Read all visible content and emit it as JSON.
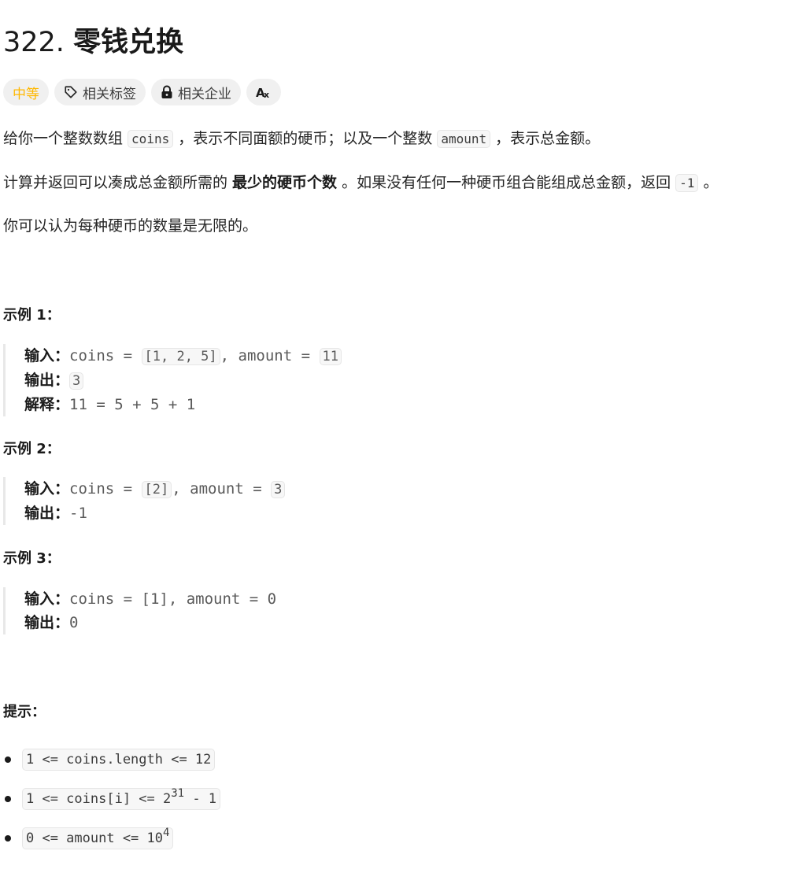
{
  "problem": {
    "number": "322.",
    "title": "零钱兑换"
  },
  "tags": {
    "difficulty": "中等",
    "related_tags": "相关标签",
    "related_companies": "相关企业",
    "translate_icon": "translate-icon",
    "difficulty_color": "#ffb800"
  },
  "description": {
    "p1": {
      "t1": "给你一个整数数组 ",
      "c1": "coins",
      "t2": " ，表示不同面额的硬币；以及一个整数 ",
      "c2": "amount",
      "t3": " ，表示总金额。"
    },
    "p2": {
      "t1": "计算并返回可以凑成总金额所需的 ",
      "bold": "最少的硬币个数",
      "t2": " 。如果没有任何一种硬币组合能组成总金额，返回 ",
      "c1": "-1",
      "t3": " 。"
    },
    "p3": "你可以认为每种硬币的数量是无限的。"
  },
  "examples": [
    {
      "heading": "示例 1：",
      "input_label": "输入：",
      "input_pre": "coins = ",
      "input_coins": "[1, 2, 5]",
      "input_mid": ", amount = ",
      "input_amount": "11",
      "output_label": "输出：",
      "output": "3",
      "explain_label": "解释：",
      "explain": "11 = 5 + 5 + 1"
    },
    {
      "heading": "示例 2：",
      "input_label": "输入：",
      "input_pre": "coins = ",
      "input_coins": "[2]",
      "input_mid": ", amount = ",
      "input_amount": "3",
      "output_label": "输出：",
      "output": "-1"
    },
    {
      "heading": "示例 3：",
      "input_label": "输入：",
      "input": "coins = [1], amount = 0",
      "output_label": "输出：",
      "output": "0"
    }
  ],
  "constraints": {
    "heading": "提示：",
    "items": [
      {
        "text": "1 <= coins.length <= 12"
      },
      {
        "text": "1 <= coins[i] <= 2",
        "sup": "31",
        "tail": " - 1"
      },
      {
        "text": "0 <= amount <= 10",
        "sup": "4"
      }
    ]
  }
}
